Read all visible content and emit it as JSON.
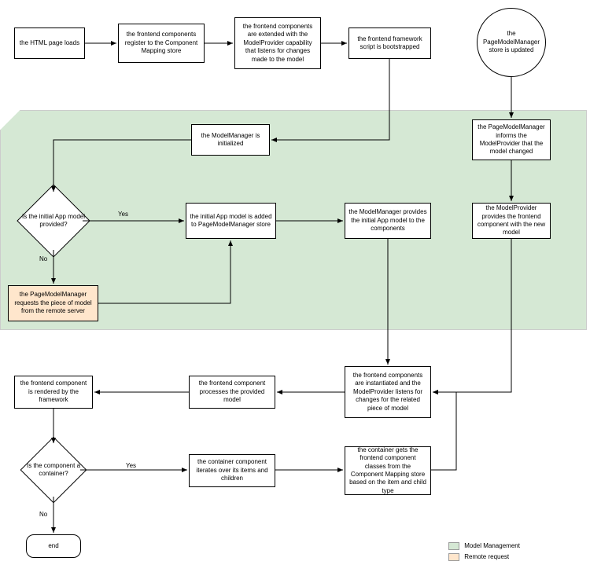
{
  "nodes": {
    "n1": "the HTML page loads",
    "n2": "the frontend components register to the Component Mapping store",
    "n3": "the frontend components are extended with the ModelProvider capability that listens for changes made to the model",
    "n4": "the frontend framework script is bootstrapped",
    "n5": "the PageModelManager store is updated",
    "n6": "the ModelManager is initialized",
    "n7": "the PageModelManager informs the ModelProvider that the model changed",
    "n8": "Is the initial App model provided?",
    "n9": "the initial App model is added to PageModelManager store",
    "n10": "the ModelManager provides the initial App model to the components",
    "n11": "the ModelProvider provides the frontend component with the new model",
    "n12": "the PageModelManager requests the piece of model from the remote server",
    "n13": "the frontend components are instantiated and the ModelProvider listens for changes for the related piece of model",
    "n14": "the frontend component processes the provided model",
    "n15": "the frontend component is rendered by the framework",
    "n16": "Is the component a container?",
    "n17": "the container component iterates over its items and children",
    "n18": "the container gets the frontend component classes from the Component Mapping store based on the item and child type",
    "n19": "end"
  },
  "labels": {
    "yes1": "Yes",
    "no1": "No",
    "yes2": "Yes",
    "no2": "No"
  },
  "legend": {
    "model": "Model Management",
    "remote": "Remote request"
  },
  "colors": {
    "green": "#d5e8d4",
    "orange": "#ffe6cc"
  }
}
